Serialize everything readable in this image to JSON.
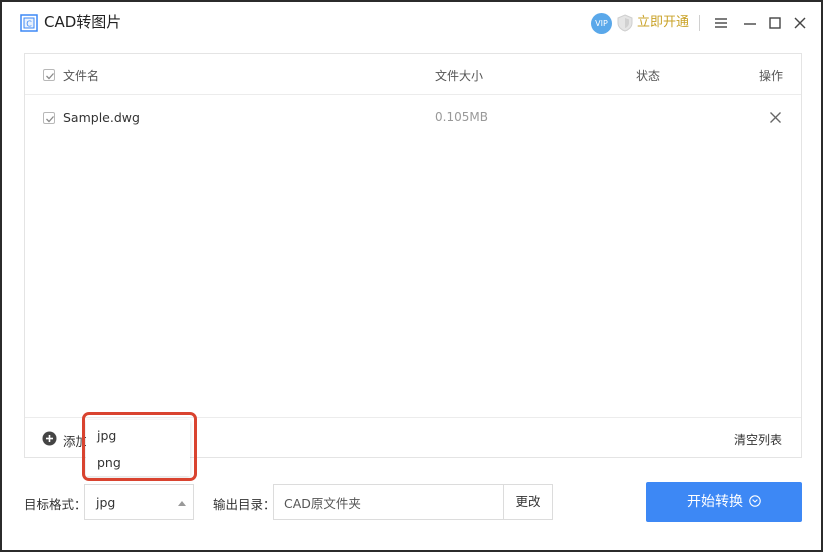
{
  "app": {
    "title": "CAD转图片",
    "vip_badge": "VIP",
    "upgrade_label": "立即开通"
  },
  "icons": {
    "logo": "cad-logo-icon",
    "vip": "vip-icon",
    "shield": "shield-icon",
    "menu": "menu-icon",
    "minimize": "minimize-icon",
    "maximize": "maximize-icon",
    "close": "close-icon",
    "add": "add-circle-icon",
    "remove": "remove-icon",
    "caret": "caret-up-icon",
    "start_chevron": "chevron-down-circle-icon"
  },
  "colors": {
    "accent": "#3d88f5",
    "upgrade": "#c9a227",
    "highlight": "#d9432f"
  },
  "list": {
    "columns": {
      "name": "文件名",
      "size": "文件大小",
      "status": "状态",
      "action": "操作"
    },
    "rows": [
      {
        "checked": true,
        "name": "Sample.dwg",
        "size": "0.105MB",
        "status": ""
      }
    ],
    "add_label": "添加",
    "clear_label": "清空列表"
  },
  "format": {
    "label": "目标格式：",
    "value": "jpg",
    "options": [
      "jpg",
      "png"
    ]
  },
  "output": {
    "label": "输出目录：",
    "value": "CAD原文件夹",
    "change_label": "更改"
  },
  "start_button": {
    "label": "开始转换"
  }
}
